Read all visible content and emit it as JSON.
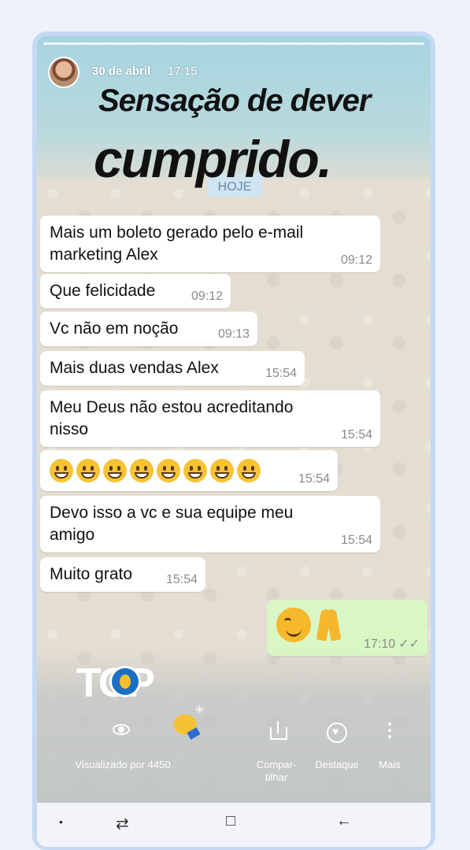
{
  "story": {
    "date": "30 de abril",
    "time": "17:15",
    "caption_line1": "Sensação de dever",
    "caption_line2": "cumprido."
  },
  "chat": {
    "day_label": "HOJE",
    "messages": [
      {
        "text": "Mais um boleto gerado pelo e-mail marketing Alex",
        "line1": "Mais um boleto gerado pelo e-mail",
        "line2": "marketing Alex",
        "time": "09:12"
      },
      {
        "text": "Que felicidade",
        "time": "09:12"
      },
      {
        "text": "Vc não em noção",
        "time": "09:13"
      },
      {
        "text": "Mais duas vendas Alex",
        "time": "15:54"
      },
      {
        "text": "Meu Deus não estou acreditando nisso",
        "line1": "Meu Deus não estou acreditando",
        "line2": "nisso",
        "time": "15:54"
      },
      {
        "text": "",
        "emoji": "grinning-face",
        "emoji_count": 8,
        "time": "15:54"
      },
      {
        "text": "Devo isso a vc e sua equipe meu amigo",
        "line1": "Devo isso a vc e sua equipe meu",
        "line2": "amigo",
        "time": "15:54"
      },
      {
        "text": "Muito grato",
        "time": "15:54"
      }
    ],
    "outgoing": {
      "emoji": [
        "smiling-face-icon",
        "folded-hands-icon"
      ],
      "time": "17:10",
      "status": "✓✓"
    }
  },
  "footer": {
    "viewed_label": "Visualizado por 4450",
    "share_label_1": "Compar-",
    "share_label_2": "tilhar",
    "highlight_label": "Destaque",
    "more_label": "Mais",
    "logo_text": "TOP"
  },
  "colors": {
    "bubble_in": "#ffffff",
    "bubble_out": "#d8f7c5",
    "frame": "#c5d9f5",
    "page_bg": "#edf2fb"
  },
  "nav": {
    "dot": "•",
    "recent": "⇄",
    "home": "□",
    "back": "←"
  }
}
